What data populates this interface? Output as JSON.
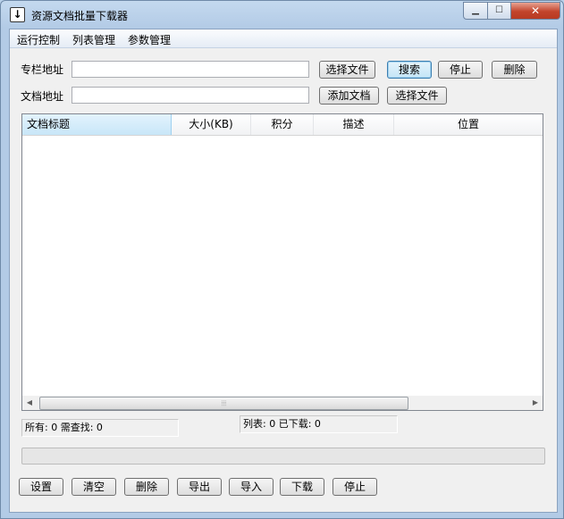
{
  "window": {
    "title": "资源文档批量下载器",
    "caption": {
      "minimize": "▁",
      "maximize": "☐",
      "close": "✕"
    }
  },
  "menu": {
    "items": [
      "运行控制",
      "列表管理",
      "参数管理"
    ]
  },
  "form": {
    "column_url_label": "专栏地址",
    "column_url_value": "",
    "doc_url_label": "文档地址",
    "doc_url_value": "",
    "buttons_row1": [
      "选择文件",
      "搜索",
      "停止",
      "删除"
    ],
    "buttons_row2": [
      "添加文档",
      "选择文件"
    ]
  },
  "list": {
    "columns": [
      "文档标题",
      "大小(KB)",
      "积分",
      "描述",
      "位置"
    ],
    "rows": [],
    "scroll": {
      "left_arrow": "◀",
      "right_arrow": "▶",
      "thumb_grip": "⦙⦙⦙"
    }
  },
  "status": {
    "left": "所有: 0 需查找: 0",
    "right": "列表: 0 已下载: 0"
  },
  "progress": {
    "fraction": 0
  },
  "toolbar": {
    "buttons": [
      "设置",
      "清空",
      "删除",
      "导出",
      "导入",
      "下载",
      "停止"
    ]
  }
}
